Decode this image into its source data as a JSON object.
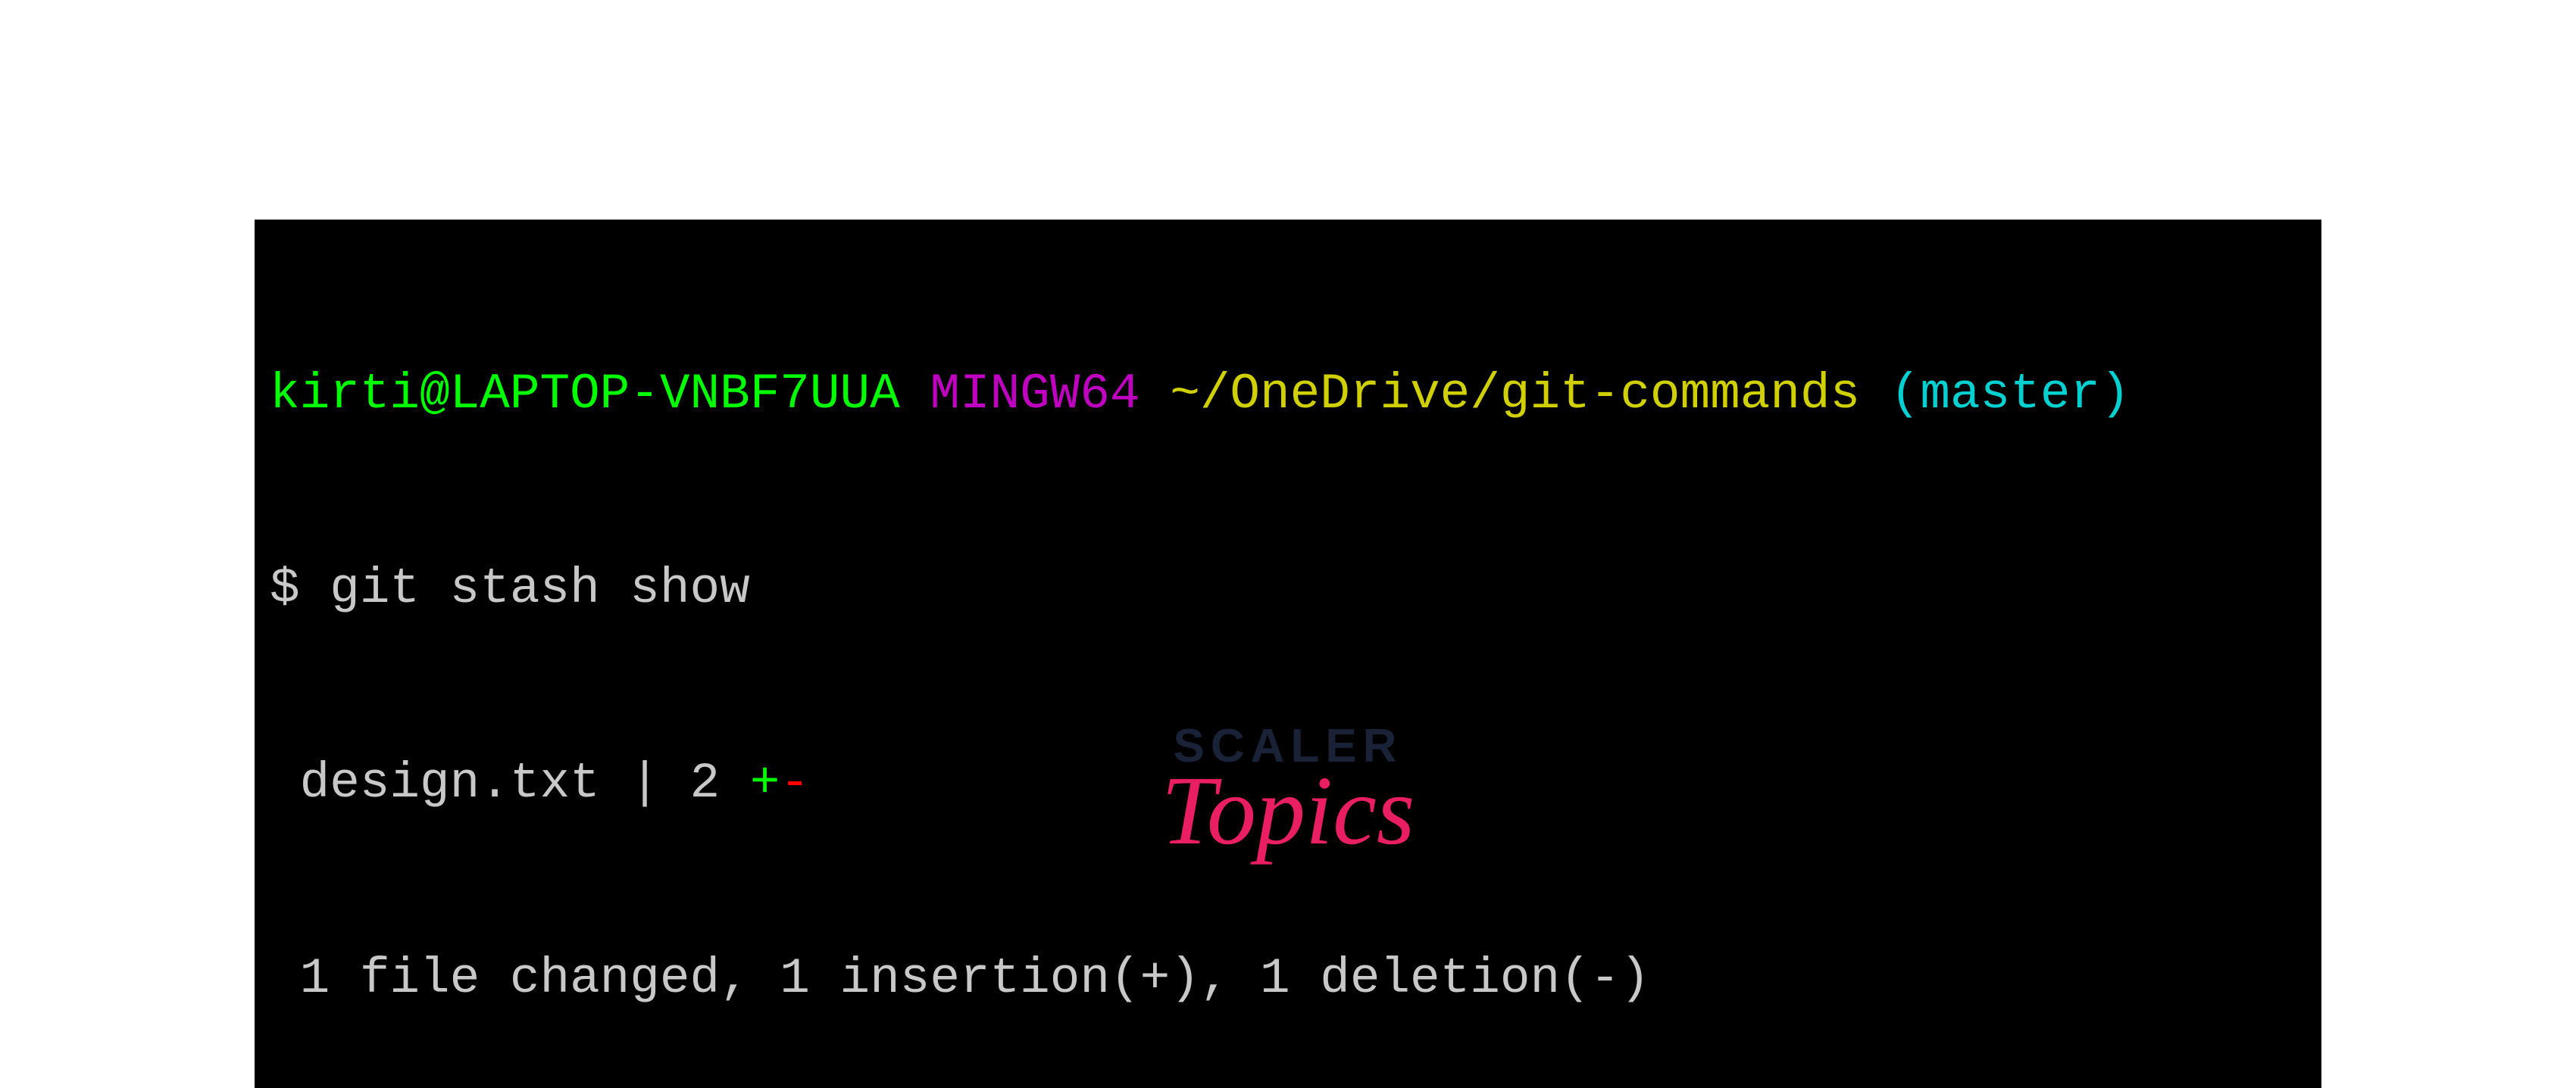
{
  "terminal": {
    "prompt": {
      "user_host": "kirti@LAPTOP-VNBF7UUA",
      "mingw": "MINGW64",
      "path": "~/OneDrive/git-commands",
      "branch": "(master)"
    },
    "command": "$ git stash show",
    "output": {
      "file_line_prefix": " design.txt | 2 ",
      "plus": "+",
      "minus": "-",
      "summary": " 1 file changed, 1 insertion(+), 1 deletion(-)"
    }
  },
  "logo": {
    "scaler": "SCALER",
    "topics": "Topics"
  }
}
